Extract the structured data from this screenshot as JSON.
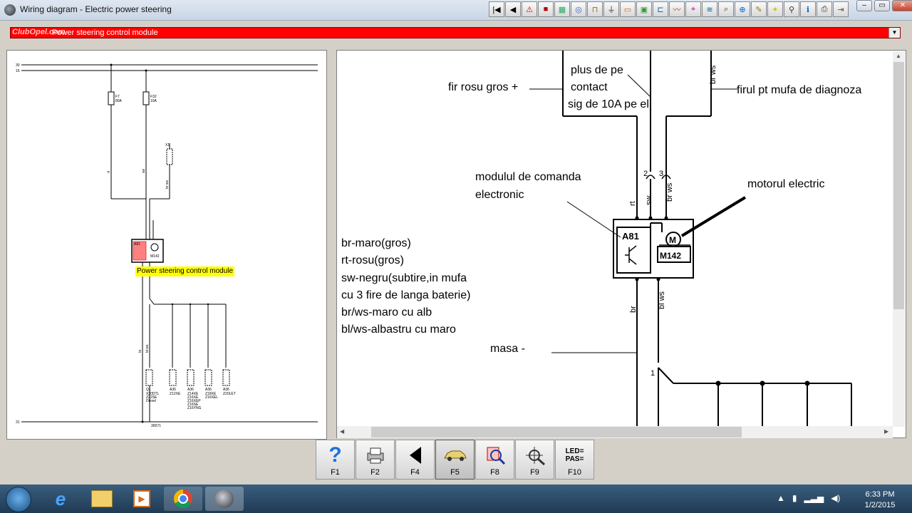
{
  "window": {
    "title": "Wiring diagram - Electric power steering",
    "min_label": "–",
    "max_label": "▭",
    "close_label": "✕"
  },
  "toolbar_icons": [
    "first-page-icon",
    "prev-page-icon",
    "warning-icon",
    "stop-icon",
    "diagram-icon",
    "component-icon",
    "connector-icon",
    "ground-icon",
    "fuse-icon",
    "relay-icon",
    "plug-icon",
    "wire-icon",
    "location-icon",
    "harness-icon",
    "search-icon",
    "zoom-icon",
    "tool-icon",
    "lightbulb-icon",
    "test-icon",
    "info-icon",
    "print-icon",
    "exit-icon"
  ],
  "selector": {
    "logo": "ClubOpel.com",
    "value": "Power steering control module"
  },
  "left_diagram": {
    "bus_labels": [
      "30",
      "15",
      "31"
    ],
    "fuse1": {
      "name": "F7",
      "rating": "80A"
    },
    "fuse2": {
      "name": "F32",
      "rating": "10A"
    },
    "connector": "X1",
    "module_labels": [
      "A81",
      "M142"
    ],
    "component_label": "Power steering control module",
    "wire_labels": [
      "rt",
      "sw",
      "br ws",
      "br",
      "bl ws"
    ],
    "bottom_components": [
      {
        "id": "Q1",
        "notes": [
          "X20DTL",
          "Z22SE",
          "Diesel"
        ]
      },
      {
        "id": "A36",
        "notes": [
          "Z12XE"
        ]
      },
      {
        "id": "A36",
        "notes": [
          "Z14XE",
          "Z16XE",
          "Z16XEP",
          "Z16SE",
          "Z16YNG"
        ]
      },
      {
        "id": "A36",
        "notes": [
          "Z18XE",
          "Z16XEL"
        ]
      },
      {
        "id": "A36",
        "notes": [
          "Z20LET"
        ]
      }
    ],
    "ground_ref": "30071"
  },
  "right_diagram": {
    "annotations": {
      "fir_rosu": "fir rosu gros +",
      "plus_contact": [
        "plus de pe",
        "contact",
        "sig de 10A pe el"
      ],
      "firul_diag": "firul pt mufa de diagnoza",
      "modulul": [
        "modulul de comanda",
        "electronic"
      ],
      "motorul": "motorul electric",
      "masa": "masa -"
    },
    "color_notes": [
      "br-maro(gros)",
      "rt-rosu(gros)",
      "sw-negru(subtire,in mufa",
      "cu 3 fire de langa baterie)",
      "br/ws-maro cu alb",
      "bl/ws-albastru cu maro"
    ],
    "wire_labels": {
      "br_ws_top": "br ws",
      "pin2": "2",
      "pin3": "3",
      "rt": "rt",
      "sw": "sw",
      "br_ws": "br ws",
      "br": "br",
      "bl_ws": "bl ws",
      "pin1": "1"
    },
    "module_labels": {
      "a81": "A81",
      "m": "M",
      "m142": "M142"
    }
  },
  "function_keys": [
    {
      "key": "F1",
      "icon": "help-icon"
    },
    {
      "key": "F2",
      "icon": "print-icon"
    },
    {
      "key": "F4",
      "icon": "back-arrow-icon"
    },
    {
      "key": "F5",
      "icon": "car-icon",
      "active": true
    },
    {
      "key": "F8",
      "icon": "search-component-icon"
    },
    {
      "key": "F9",
      "icon": "locate-icon"
    },
    {
      "key": "F10",
      "icon": "led-pass-icon",
      "text": [
        "LED=",
        "PAS="
      ]
    }
  ],
  "taskbar": {
    "apps": [
      "ie-icon",
      "explorer-icon",
      "media-player-icon",
      "chrome-icon",
      "opel-app-icon"
    ],
    "time": "6:33 PM",
    "date": "1/2/2015"
  }
}
